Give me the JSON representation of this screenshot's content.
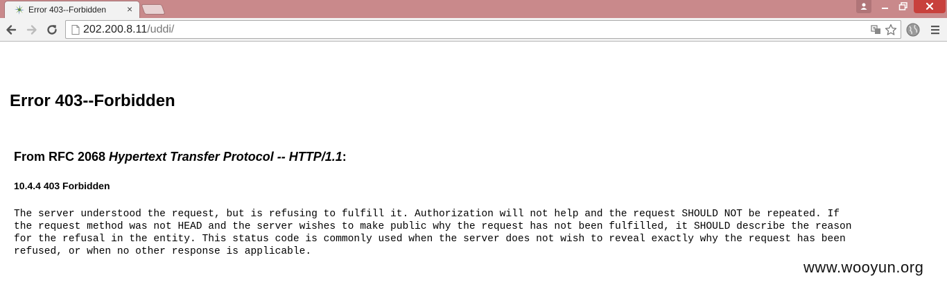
{
  "browser": {
    "tab_title": "Error 403--Forbidden",
    "tab_close_glyph": "×",
    "url_host": "202.200.8.11",
    "url_path": "/uddi/"
  },
  "page": {
    "heading": "Error 403--Forbidden",
    "rfc_prefix": "From RFC 2068 ",
    "rfc_title": "Hypertext Transfer Protocol -- HTTP/1.1",
    "rfc_suffix": ":",
    "section": "10.4.4 403 Forbidden",
    "lines": [
      "The server understood the request, but is refusing to fulfill it. Authorization will not help and the request SHOULD NOT be repeated. If",
      "the request method was not HEAD and the server wishes to make public why the request has not been fulfilled, it SHOULD describe the reason",
      "for the refusal in the entity. This status code is commonly used when the server does not wish to reveal exactly why the request has been",
      "refused, or when no other response is applicable."
    ]
  },
  "watermark": "www.wooyun.org",
  "colors": {
    "titlebar": "#c9898b",
    "close_button": "#c8403c",
    "toolbar": "#f2f2f2"
  }
}
